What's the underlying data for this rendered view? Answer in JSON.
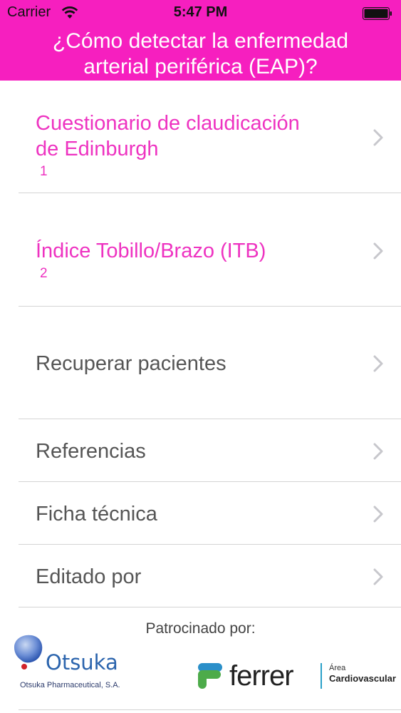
{
  "status_bar": {
    "carrier": "Carrier",
    "time": "5:47 PM"
  },
  "header": {
    "title_line1": "¿Cómo detectar la enfermedad",
    "title_line2": "arterial periférica (EAP)?"
  },
  "menu": {
    "items": [
      {
        "line1": "Cuestionario de claudicación",
        "line2": "de Edinburgh",
        "sup": "1"
      },
      {
        "label": "Índice Tobillo/Brazo (ITB)",
        "sup": "2"
      },
      {
        "label": "Recuperar pacientes"
      },
      {
        "label": "Referencias"
      },
      {
        "label": "Ficha técnica"
      },
      {
        "label": "Editado por"
      }
    ]
  },
  "footer": {
    "sponsor_label": "Patrocinado por:",
    "otsuka_name": "Otsuka",
    "otsuka_full": "Otsuka Pharmaceutical, S.A.",
    "ferrer_name": "ferrer",
    "area_top": "Área",
    "area_bottom": "Cardiovascular"
  },
  "colors": {
    "header_bg": "#f61fbf",
    "accent_pink": "#ee33c1",
    "text_gray": "#555555",
    "chevron": "#c7c7cc"
  }
}
